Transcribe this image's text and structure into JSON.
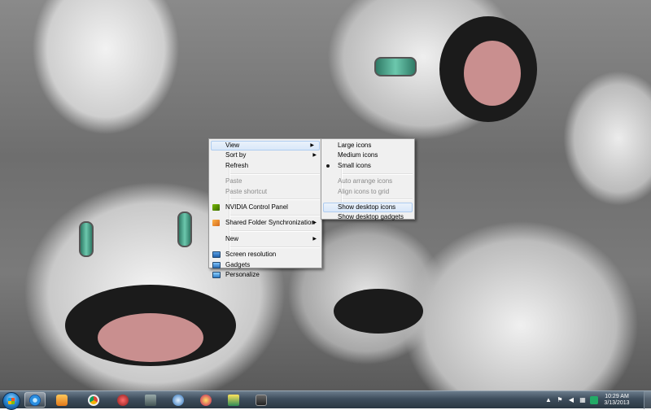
{
  "context_menu": {
    "items": [
      {
        "label": "View",
        "submenu": true,
        "enabled": true,
        "highlighted": true
      },
      {
        "label": "Sort by",
        "submenu": true,
        "enabled": true
      },
      {
        "label": "Refresh",
        "enabled": true
      },
      {
        "separator": true
      },
      {
        "label": "Paste",
        "enabled": false
      },
      {
        "label": "Paste shortcut",
        "enabled": false
      },
      {
        "separator": true
      },
      {
        "label": "NVIDIA Control Panel",
        "enabled": true,
        "icon": "nvidia-icon"
      },
      {
        "separator": true
      },
      {
        "label": "Shared Folder Synchronization",
        "submenu": true,
        "enabled": true,
        "icon": "shared-folder-icon"
      },
      {
        "separator": true
      },
      {
        "label": "New",
        "submenu": true,
        "enabled": true
      },
      {
        "separator": true
      },
      {
        "label": "Screen resolution",
        "enabled": true,
        "icon": "screen-resolution-icon"
      },
      {
        "label": "Gadgets",
        "enabled": true,
        "icon": "gadgets-icon"
      },
      {
        "label": "Personalize",
        "enabled": true,
        "icon": "personalize-icon"
      }
    ]
  },
  "view_submenu": {
    "items": [
      {
        "label": "Large icons",
        "enabled": true
      },
      {
        "label": "Medium icons",
        "enabled": true
      },
      {
        "label": "Small icons",
        "enabled": true,
        "selected": true
      },
      {
        "separator": true
      },
      {
        "label": "Auto arrange icons",
        "enabled": false
      },
      {
        "label": "Align icons to grid",
        "enabled": false
      },
      {
        "separator": true
      },
      {
        "label": "Show desktop icons",
        "enabled": true,
        "highlighted": true
      },
      {
        "label": "Show desktop gadgets",
        "enabled": true
      }
    ]
  },
  "taskbar": {
    "pinned": [
      {
        "name": "internet-explorer-icon",
        "active": true
      },
      {
        "name": "media-player-icon"
      },
      {
        "name": "chrome-icon"
      },
      {
        "name": "app-icon-4"
      },
      {
        "name": "app-icon-5"
      },
      {
        "name": "app-icon-6"
      },
      {
        "name": "app-icon-7"
      },
      {
        "name": "app-icon-8"
      },
      {
        "name": "app-icon-9"
      }
    ],
    "clock": {
      "time": "10:29 AM",
      "date": "3/13/2013"
    }
  },
  "colors": {
    "menu_bg": "#f0f0f0",
    "menu_highlight": "#d9e8f9",
    "taskbar": "#3e4d5c"
  }
}
